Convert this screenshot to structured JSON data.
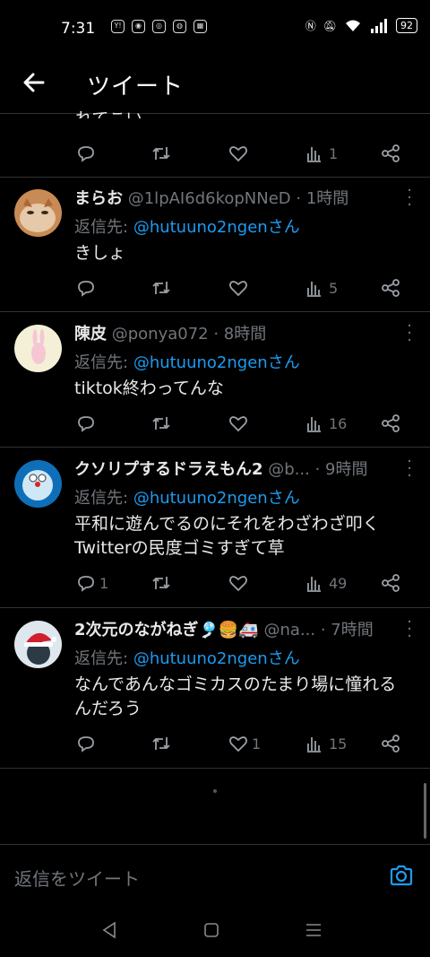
{
  "status": {
    "time": "7:31",
    "app_icons": [
      "Y!",
      "LINE",
      "ig",
      "chrome",
      "ab"
    ],
    "battery": "92"
  },
  "header": {
    "title": "ツイート"
  },
  "prev_tweet": {
    "text_fragment": "れてこい",
    "views": "1"
  },
  "tweets": [
    {
      "name": "まらお",
      "handle": "@1lpAI6d6kopNNeD",
      "time": "· 1時間",
      "reply_prefix": "返信先:",
      "reply_account": "@hutuuno2ngenさん",
      "lines": [
        "きしょ"
      ],
      "replies": "",
      "likes": "",
      "views": "5"
    },
    {
      "name": "陳皮",
      "handle": "@ponya072",
      "time": "· 8時間",
      "reply_prefix": "返信先:",
      "reply_account": "@hutuuno2ngenさん",
      "lines": [
        "tiktok終わってんな"
      ],
      "replies": "",
      "likes": "",
      "views": "16"
    },
    {
      "name": "クソリプするドラえもん2",
      "handle": "@b...",
      "time": "· 9時間",
      "reply_prefix": "返信先:",
      "reply_account": "@hutuuno2ngenさん",
      "lines": [
        "平和に遊んでるのにそれをわざわざ叩く",
        "Twitterの民度ゴミすぎて草"
      ],
      "replies": "1",
      "likes": "",
      "views": "49"
    },
    {
      "name": "2次元のながねぎ🎐🍔🚑",
      "handle": "@na...",
      "time": "· 7時間",
      "reply_prefix": "返信先:",
      "reply_account": "@hutuuno2ngenさん",
      "lines": [
        "なんであんなゴミカスのたまり場に憧れる",
        "んだろう"
      ],
      "replies": "",
      "likes": "1",
      "views": "15"
    }
  ],
  "compose": {
    "placeholder": "返信をツイート"
  },
  "colors": {
    "accent": "#1d9bf0",
    "muted": "#71767b",
    "divider": "#2f3336"
  }
}
